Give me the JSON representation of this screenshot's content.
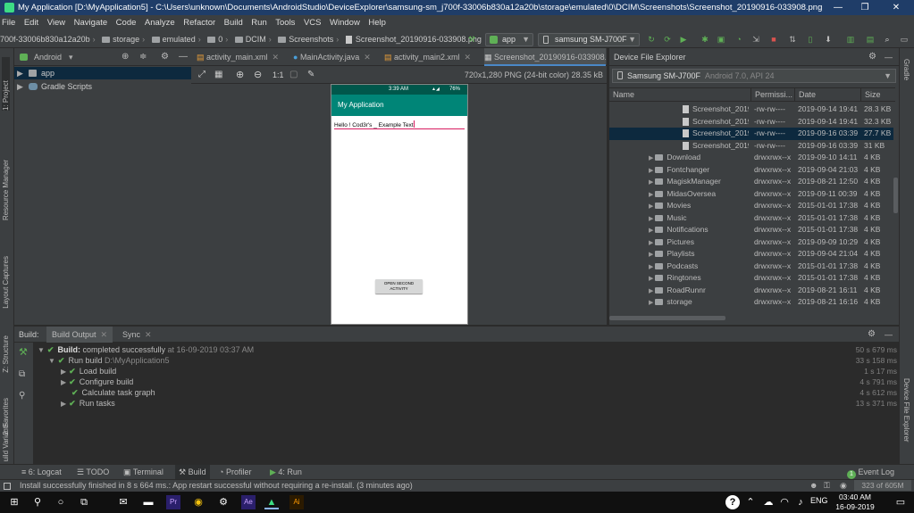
{
  "window": {
    "title": "My Application [D:\\MyApplication5] - C:\\Users\\unknown\\Documents\\AndroidStudio\\DeviceExplorer\\samsung-sm_j700f-33006b830a12a20b\\storage\\emulated\\0\\DCIM\\Screenshots\\Screenshot_20190916-033908.png - Android ...",
    "minimize": "—",
    "restore": "❐",
    "close": "✕"
  },
  "menu": [
    "File",
    "Edit",
    "View",
    "Navigate",
    "Code",
    "Analyze",
    "Refactor",
    "Build",
    "Run",
    "Tools",
    "VCS",
    "Window",
    "Help"
  ],
  "breadcrumbs": [
    "700f-33006b830a12a20b",
    "storage",
    "emulated",
    "0",
    "DCIM",
    "Screenshots",
    "Screenshot_20190916-033908.png"
  ],
  "toolbar": {
    "run_config": "app",
    "device": "samsung SM-J700F"
  },
  "left_tabs": {
    "project": "1: Project",
    "resource_manager": "Resource Manager",
    "layout_captures": "Layout Captures",
    "structure": "Z: Structure",
    "favorites": "2: Favorites",
    "build_variants": "uild Variants"
  },
  "right_tabs": {
    "gradle": "Gradle",
    "device_file_explorer": "Device File Explorer"
  },
  "project": {
    "view": "Android",
    "items": [
      "app",
      "Gradle Scripts"
    ]
  },
  "editor_tabs": [
    "activity_main.xml",
    "MainActivity.java",
    "activity_main2.xml",
    "Screenshot_20190916-033908.png"
  ],
  "image_info": "720x1,280 PNG (24-bit color) 28.35 kB",
  "zoom_label": "1:1",
  "phone": {
    "time": "3:39 AM",
    "battery": "76%",
    "app_title": "My Application",
    "text": "Hello ! Cod3r's _ Example Text",
    "button": "OPEN SECOND ACTIVITY",
    "colors": {
      "toolbar": "#008577",
      "status": "#00574b",
      "accent": "#d81b60"
    }
  },
  "device_explorer": {
    "title": "Device File Explorer",
    "device": "Samsung SM-J700F",
    "device_api": "Android 7.0, API 24",
    "columns": [
      "Name",
      "Permissi...",
      "Date",
      "Size"
    ],
    "rows": [
      {
        "name": "Screenshot_2019",
        "perm": "-rw-rw----",
        "date": "2019-09-14 19:41",
        "size": "28.3 KB",
        "type": "file"
      },
      {
        "name": "Screenshot_2019",
        "perm": "-rw-rw----",
        "date": "2019-09-14 19:41",
        "size": "32.3 KB",
        "type": "file"
      },
      {
        "name": "Screenshot_2019",
        "perm": "-rw-rw----",
        "date": "2019-09-16 03:39",
        "size": "27.7 KB",
        "type": "file",
        "selected": true
      },
      {
        "name": "Screenshot_2019",
        "perm": "-rw-rw----",
        "date": "2019-09-16 03:39",
        "size": "31 KB",
        "type": "file"
      },
      {
        "name": "Download",
        "perm": "drwxrwx--x",
        "date": "2019-09-10 14:11",
        "size": "4 KB",
        "type": "folder"
      },
      {
        "name": "Fontchanger",
        "perm": "drwxrwx--x",
        "date": "2019-09-04 21:03",
        "size": "4 KB",
        "type": "folder"
      },
      {
        "name": "MagiskManager",
        "perm": "drwxrwx--x",
        "date": "2019-08-21 12:50",
        "size": "4 KB",
        "type": "folder"
      },
      {
        "name": "MidasOversea",
        "perm": "drwxrwx--x",
        "date": "2019-09-11 00:39",
        "size": "4 KB",
        "type": "folder"
      },
      {
        "name": "Movies",
        "perm": "drwxrwx--x",
        "date": "2015-01-01 17:38",
        "size": "4 KB",
        "type": "folder"
      },
      {
        "name": "Music",
        "perm": "drwxrwx--x",
        "date": "2015-01-01 17:38",
        "size": "4 KB",
        "type": "folder"
      },
      {
        "name": "Notifications",
        "perm": "drwxrwx--x",
        "date": "2015-01-01 17:38",
        "size": "4 KB",
        "type": "folder"
      },
      {
        "name": "Pictures",
        "perm": "drwxrwx--x",
        "date": "2019-09-09 10:29",
        "size": "4 KB",
        "type": "folder"
      },
      {
        "name": "Playlists",
        "perm": "drwxrwx--x",
        "date": "2019-09-04 21:04",
        "size": "4 KB",
        "type": "folder"
      },
      {
        "name": "Podcasts",
        "perm": "drwxrwx--x",
        "date": "2015-01-01 17:38",
        "size": "4 KB",
        "type": "folder"
      },
      {
        "name": "Ringtones",
        "perm": "drwxrwx--x",
        "date": "2015-01-01 17:38",
        "size": "4 KB",
        "type": "folder"
      },
      {
        "name": "RoadRunnr",
        "perm": "drwxrwx--x",
        "date": "2019-08-21 16:11",
        "size": "4 KB",
        "type": "folder"
      },
      {
        "name": "storage",
        "perm": "drwxrwx--x",
        "date": "2019-08-21 16:16",
        "size": "4 KB",
        "type": "folder"
      }
    ]
  },
  "build": {
    "tabs": [
      "Build:",
      "Build Output",
      "Sync"
    ],
    "rows": [
      {
        "label": "Build:",
        "text": " completed successfully",
        "suffix": " at 16-09-2019 03:37 AM",
        "duration": "50 s 679 ms"
      },
      {
        "label": "Run build",
        "suffix": " D:\\MyApplication5",
        "duration": "33 s 158 ms"
      },
      {
        "label": "Load build",
        "duration": "1 s 17 ms"
      },
      {
        "label": "Configure build",
        "duration": "4 s 791 ms"
      },
      {
        "label": "Calculate task graph",
        "duration": "4 s 612 ms"
      },
      {
        "label": "Run tasks",
        "duration": "13 s 371 ms"
      }
    ]
  },
  "bottom_tabs": [
    "6: Logcat",
    "TODO",
    "Terminal",
    "Build",
    "Profiler",
    "4: Run"
  ],
  "event_log": {
    "count": "1",
    "label": "Event Log"
  },
  "status": {
    "message": "Install successfully finished in 8 s 664 ms.: App restart successful without requiring a re-install. (3 minutes ago)",
    "memory": "323 of 605M"
  },
  "taskbar": {
    "lang": "ENG",
    "time": "03:40 AM",
    "date": "16-09-2019"
  }
}
